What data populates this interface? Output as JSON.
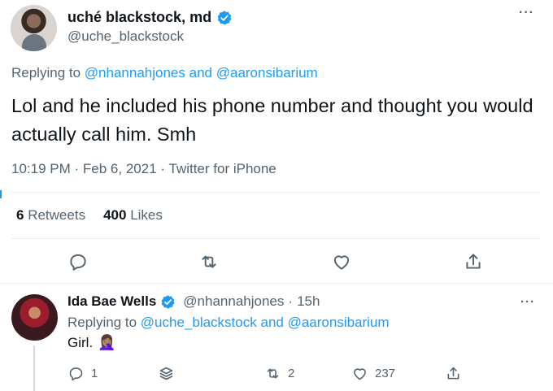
{
  "tweet": {
    "author_name": "uché blackstock, md",
    "author_handle": "@uche_blackstock",
    "reply_prefix": "Replying to",
    "reply_mention_1": "@nhannahjones",
    "reply_and": "and",
    "reply_mention_2": "@aaronsibarium",
    "text": "Lol and he included his phone number and thought you would actually call him. Smh",
    "time": "10:19 PM",
    "date": "Feb 6, 2021",
    "source": "Twitter for iPhone",
    "retweets_count": "6",
    "retweets_label": "Retweets",
    "likes_count": "400",
    "likes_label": "Likes"
  },
  "reply": {
    "author_name": "Ida Bae Wells",
    "author_handle": "@nhannahjones",
    "time_ago": "15h",
    "reply_prefix": "Replying to",
    "reply_mention_1": "@uche_blackstock",
    "reply_and": "and",
    "reply_mention_2": "@aaronsibarium",
    "text": "Girl.",
    "emoji": "🤦🏽‍♀️",
    "reply_count": "1",
    "retweet_count": "2",
    "like_count": "237"
  },
  "ui": {
    "more_glyph": "···",
    "dot_separator": "·",
    "verified_color": "#1d9bf0",
    "accent_color": "#1d9bf0"
  }
}
